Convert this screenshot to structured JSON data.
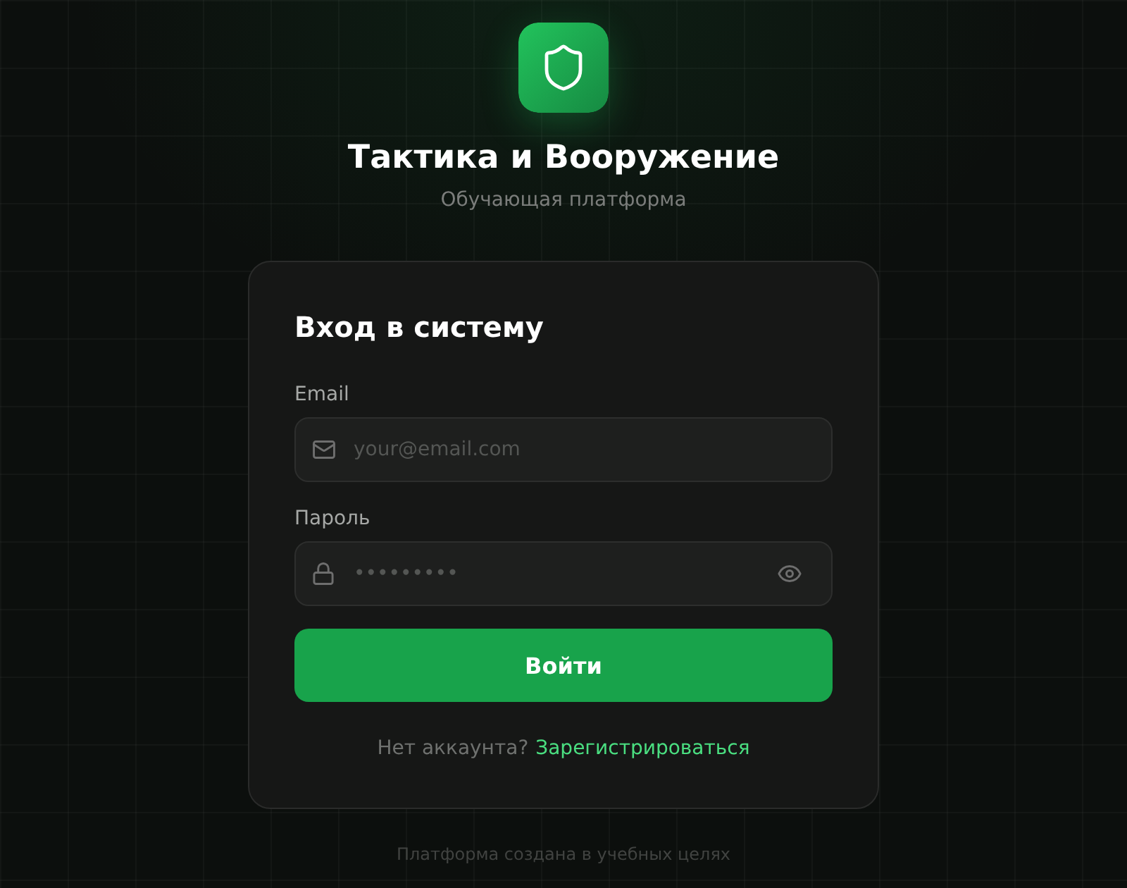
{
  "brand": {
    "title": "Тактика и Вооружение",
    "subtitle": "Обучающая платформа"
  },
  "login_card": {
    "heading": "Вход в систему",
    "fields": [
      {
        "kind": "email",
        "label": "Email",
        "placeholder": "your@email.com"
      },
      {
        "kind": "password",
        "label": "Пароль",
        "placeholder": "•••••••••"
      }
    ],
    "submit": "Войти",
    "signup_prompt": "Нет аккаунта?",
    "signup_link": "Зарегистрироваться"
  },
  "footer": "Платформа создана в учебных целях"
}
